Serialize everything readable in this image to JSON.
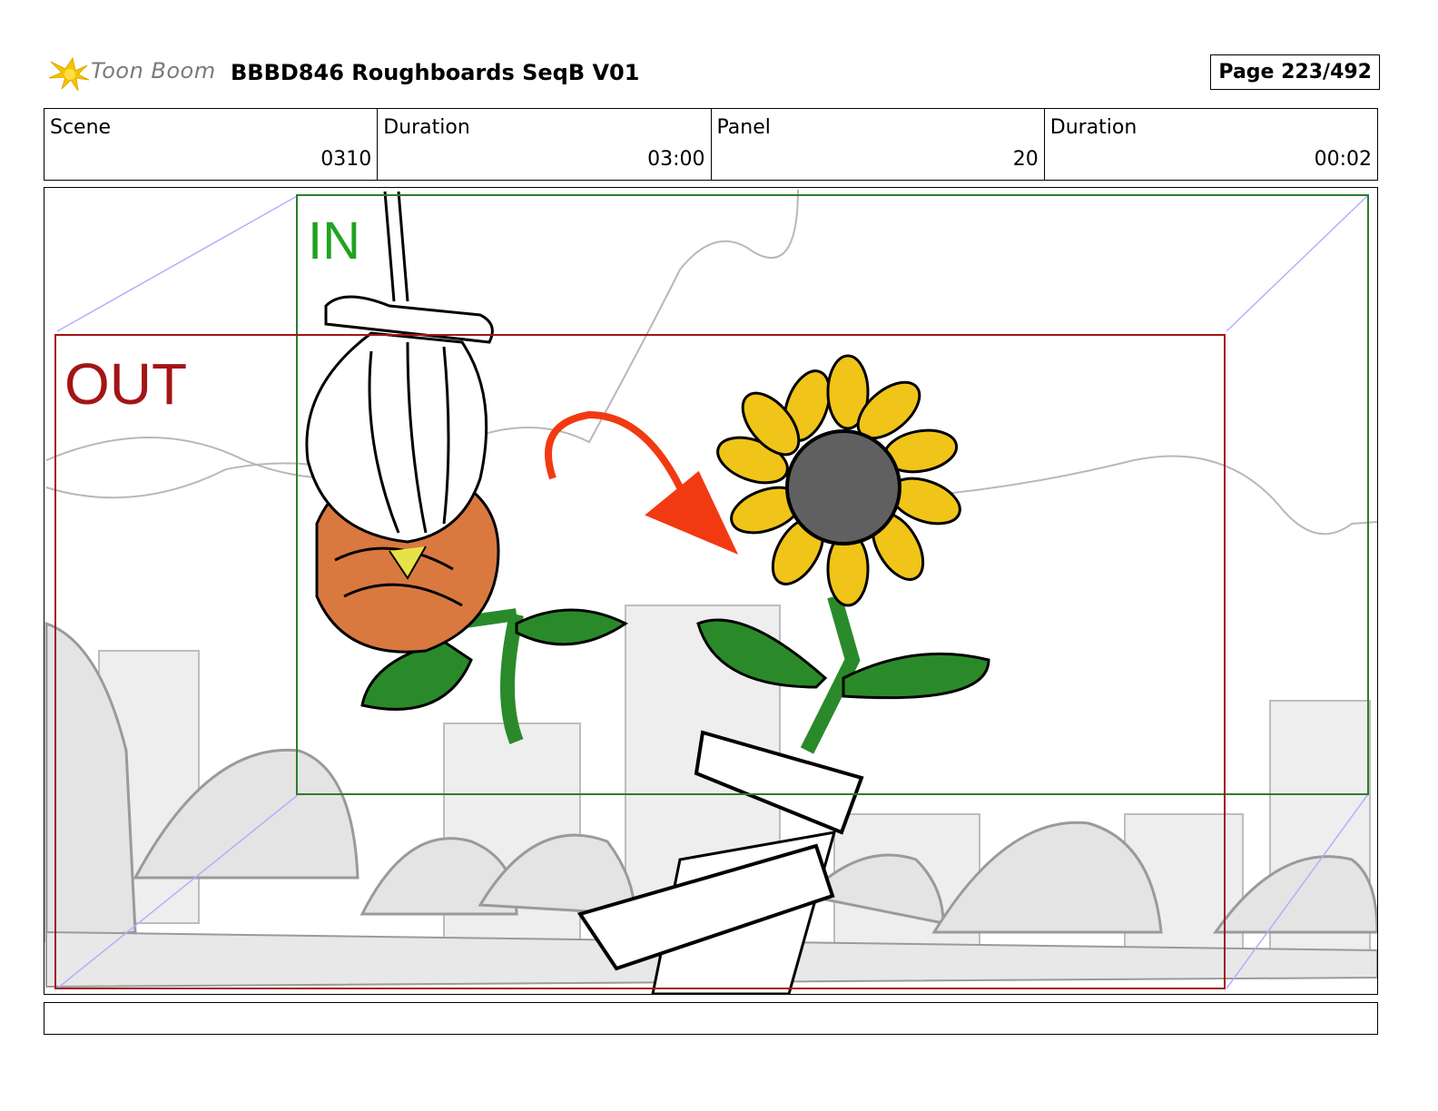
{
  "header": {
    "logo_text": "Toon Boom",
    "title": "BBBD846 Roughboards SeqB V01",
    "page": "Page 223/492"
  },
  "meta": [
    {
      "label": "Scene",
      "value": "0310"
    },
    {
      "label": "Duration",
      "value": "03:00"
    },
    {
      "label": "Panel",
      "value": "20"
    },
    {
      "label": "Duration",
      "value": "00:02"
    }
  ],
  "panel": {
    "in_label": "IN",
    "out_label": "OUT",
    "colors": {
      "in_frame": "#2e7d2e",
      "out_frame": "#a31515",
      "sunflower_petals": "#f0c419",
      "sunflower_center": "#606060",
      "orange_flower": "#d9793f",
      "leaves": "#2a8a2a",
      "arrow": "#f23a12",
      "background_sketch": "#d4d4d4"
    }
  },
  "notes": ""
}
